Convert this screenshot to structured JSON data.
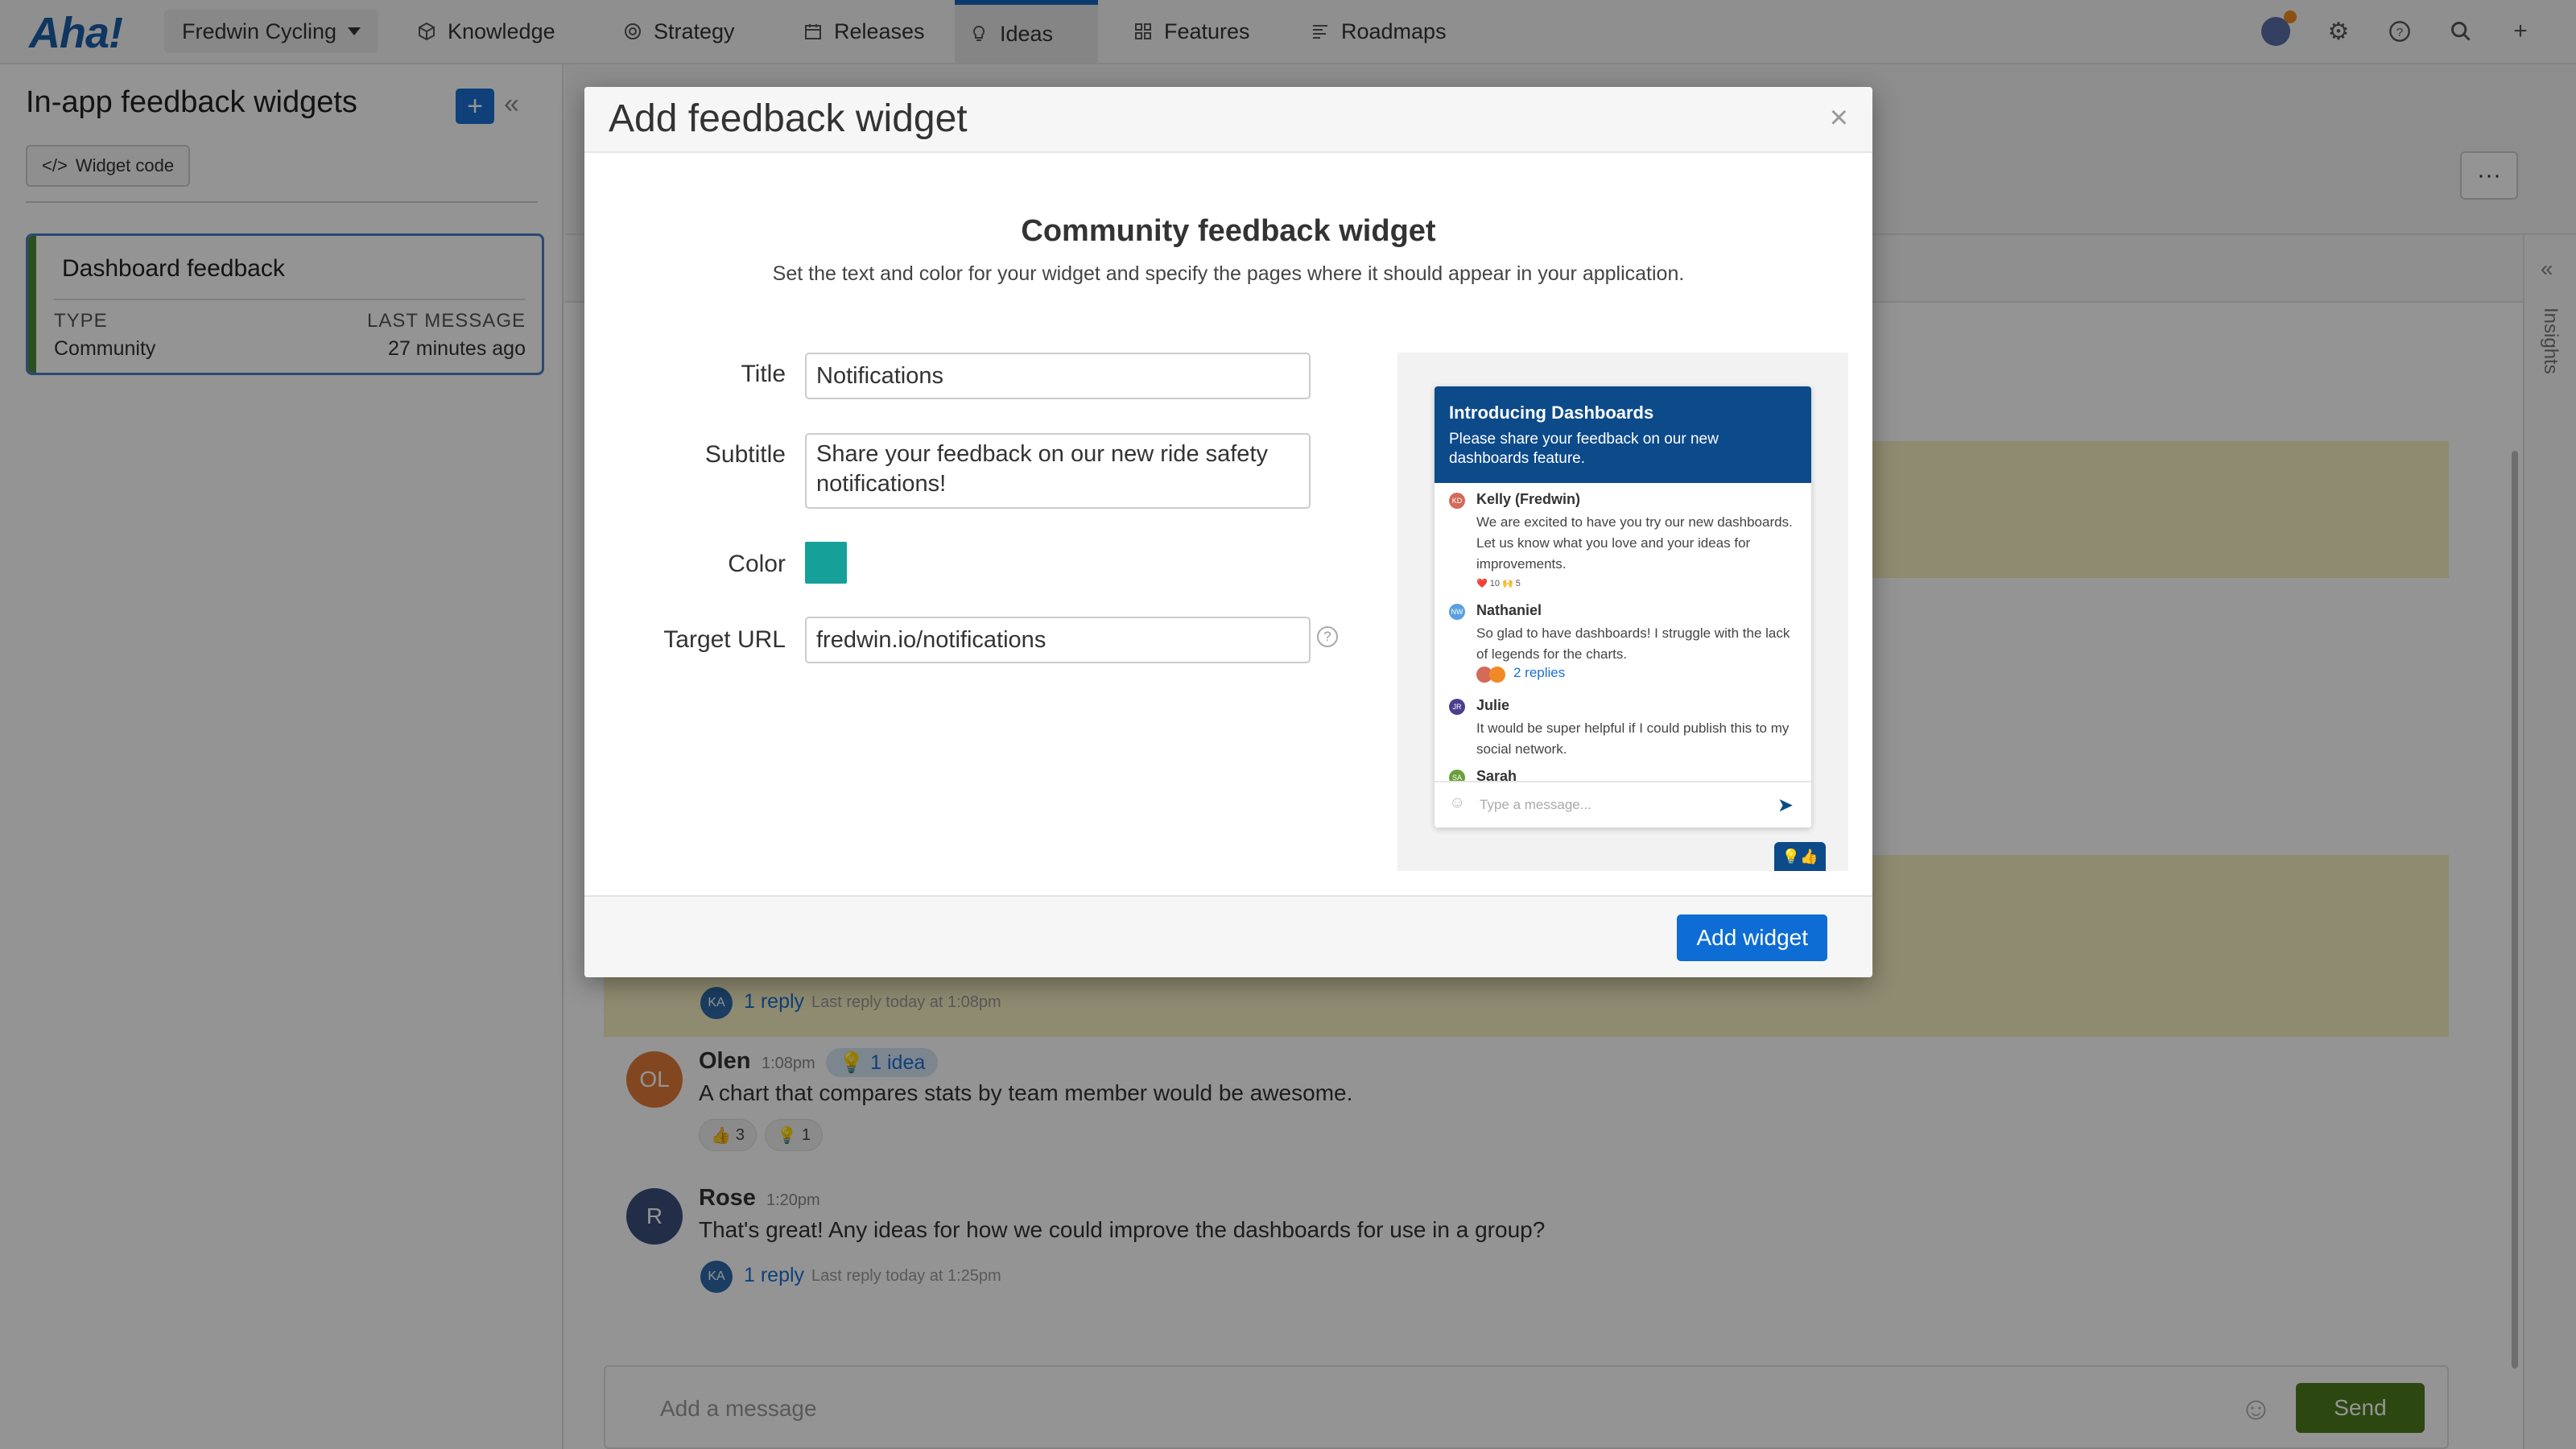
{
  "nav": {
    "logo": "Aha!",
    "workspace": "Fredwin Cycling",
    "tabs": [
      {
        "label": "Knowledge",
        "icon": "cube-icon"
      },
      {
        "label": "Strategy",
        "icon": "target-icon"
      },
      {
        "label": "Releases",
        "icon": "calendar-icon"
      },
      {
        "label": "Ideas",
        "icon": "lightbulb-icon"
      },
      {
        "label": "Features",
        "icon": "grid-icon"
      },
      {
        "label": "Roadmaps",
        "icon": "roadmap-icon"
      }
    ],
    "active_tab": "Ideas"
  },
  "sidebar": {
    "title": "In-app feedback widgets",
    "widget_code_label": "Widget code",
    "card": {
      "name": "Dashboard feedback",
      "type_label": "TYPE",
      "type_value": "Community",
      "last_label": "LAST MESSAGE",
      "last_value": "27 minutes ago"
    }
  },
  "thread": {
    "highlight_reply": {
      "avatar": "KA",
      "link": "1 reply",
      "meta": "Last reply today at 1:08pm"
    },
    "messages": [
      {
        "author": "Olen",
        "initials": "OL",
        "time": "1:08pm",
        "badge": "1 idea",
        "text": "A chart that compares stats by team member would be awesome.",
        "reactions": [
          {
            "emoji": "👍",
            "count": "3"
          },
          {
            "emoji": "💡",
            "count": "1"
          }
        ]
      },
      {
        "author": "Rose",
        "initials": "R",
        "time": "1:20pm",
        "text": "That's great! Any ideas for how we could improve the dashboards for use in a group?",
        "reply": {
          "avatar": "KA",
          "link": "1 reply",
          "meta": "Last reply today at 1:25pm"
        }
      }
    ],
    "composer_placeholder": "Add a message",
    "send_label": "Send",
    "insights_label": "Insights"
  },
  "modal": {
    "title": "Add feedback widget",
    "heading": "Community feedback widget",
    "description": "Set the text and color for your widget and specify the pages where it should appear in your application.",
    "fields": {
      "title_label": "Title",
      "title_value": "Notifications",
      "subtitle_label": "Subtitle",
      "subtitle_value": "Share your feedback on our new ride safety notifications!",
      "color_label": "Color",
      "color_value": "#16a09a",
      "url_label": "Target URL",
      "url_value": "fredwin.io/notifications"
    },
    "add_button": "Add widget",
    "preview": {
      "title": "Introducing Dashboards",
      "subtitle": "Please share your feedback on our new dashboards feature.",
      "items": [
        {
          "initials": "KD",
          "name": "Kelly (Fredwin)",
          "text": "We are excited to have you try our new dashboards. Let us know what you love and your ideas for improvements.",
          "reactions": "❤️ 10   🙌 5"
        },
        {
          "initials": "NW",
          "name": "Nathaniel",
          "text": "So glad to have dashboards! I struggle with the lack of legends for the charts.",
          "replies": "2 replies"
        },
        {
          "initials": "JR",
          "name": "Julie",
          "text": "It would be super helpful if I could publish this to my social network."
        },
        {
          "initials": "SA",
          "name": "Sarah"
        }
      ],
      "input_placeholder": "Type a message..."
    }
  },
  "colors": {
    "brand": "#1a5ea6",
    "accent": "#0e6dd4",
    "preview_header": "#0c4a8a",
    "send": "#4f7a1c",
    "highlight": "#f7efc3"
  }
}
